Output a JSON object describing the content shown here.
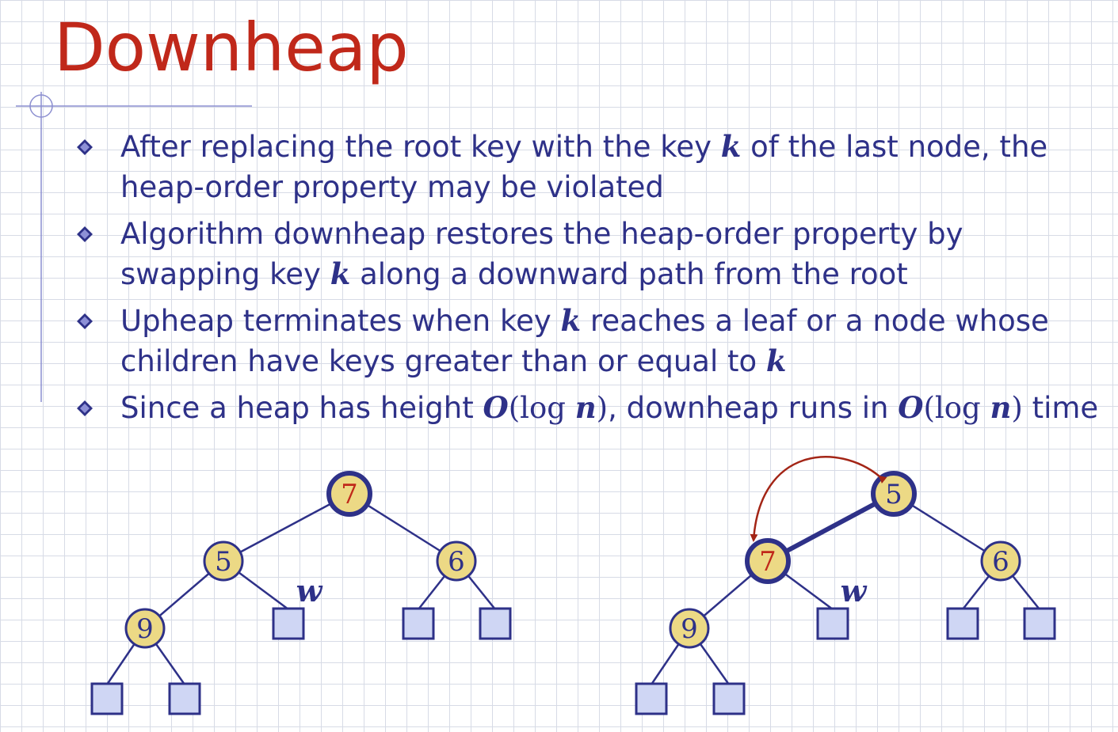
{
  "title": "Downheap",
  "bullets": [
    {
      "parts": [
        {
          "t": "After replacing the root key with the key ",
          "s": "text"
        },
        {
          "t": "k",
          "s": "math"
        },
        {
          "t": " of the last node, the heap-order property may be violated",
          "s": "text"
        }
      ]
    },
    {
      "parts": [
        {
          "t": "Algorithm downheap restores the heap-order property by swapping key ",
          "s": "text"
        },
        {
          "t": "k",
          "s": "math"
        },
        {
          "t": " along a downward path from the root",
          "s": "text"
        }
      ]
    },
    {
      "parts": [
        {
          "t": "Upheap terminates when key ",
          "s": "text"
        },
        {
          "t": "k",
          "s": "math"
        },
        {
          "t": " reaches a leaf or a node whose children have keys greater than or equal to ",
          "s": "text"
        },
        {
          "t": "k",
          "s": "math"
        }
      ]
    },
    {
      "parts": [
        {
          "t": "Since a heap has height ",
          "s": "text"
        },
        {
          "t": "O",
          "s": "math"
        },
        {
          "t": "(log ",
          "s": "mathr"
        },
        {
          "t": "n",
          "s": "math"
        },
        {
          "t": ")",
          "s": "mathr"
        },
        {
          "t": ", downheap runs in ",
          "s": "text"
        },
        {
          "t": "O",
          "s": "math"
        },
        {
          "t": "(log ",
          "s": "mathr"
        },
        {
          "t": "n",
          "s": "math"
        },
        {
          "t": ")",
          "s": "mathr"
        },
        {
          "t": " time",
          "s": "text"
        }
      ]
    }
  ],
  "trees": [
    {
      "nodes": [
        {
          "id": "root",
          "key": "7",
          "highlight": true,
          "red": true
        },
        {
          "id": "l",
          "key": "5",
          "highlight": false,
          "red": false
        },
        {
          "id": "r",
          "key": "6",
          "highlight": false,
          "red": false
        },
        {
          "id": "ll",
          "key": "9",
          "highlight": false,
          "red": false
        }
      ],
      "w_label": "w",
      "swap_arrow": false
    },
    {
      "nodes": [
        {
          "id": "root",
          "key": "5",
          "highlight": true,
          "red": false
        },
        {
          "id": "l",
          "key": "7",
          "highlight": true,
          "red": true
        },
        {
          "id": "r",
          "key": "6",
          "highlight": false,
          "red": false
        },
        {
          "id": "ll",
          "key": "9",
          "highlight": false,
          "red": false
        }
      ],
      "w_label": "w",
      "swap_arrow": true
    }
  ],
  "colors": {
    "title": "#c0281a",
    "text": "#2e3188",
    "node_fill": "#ecd985",
    "node_stroke": "#2e3188",
    "leaf_fill": "#cfd6f4",
    "red_key": "#c0281a",
    "arrow": "#a32516"
  }
}
